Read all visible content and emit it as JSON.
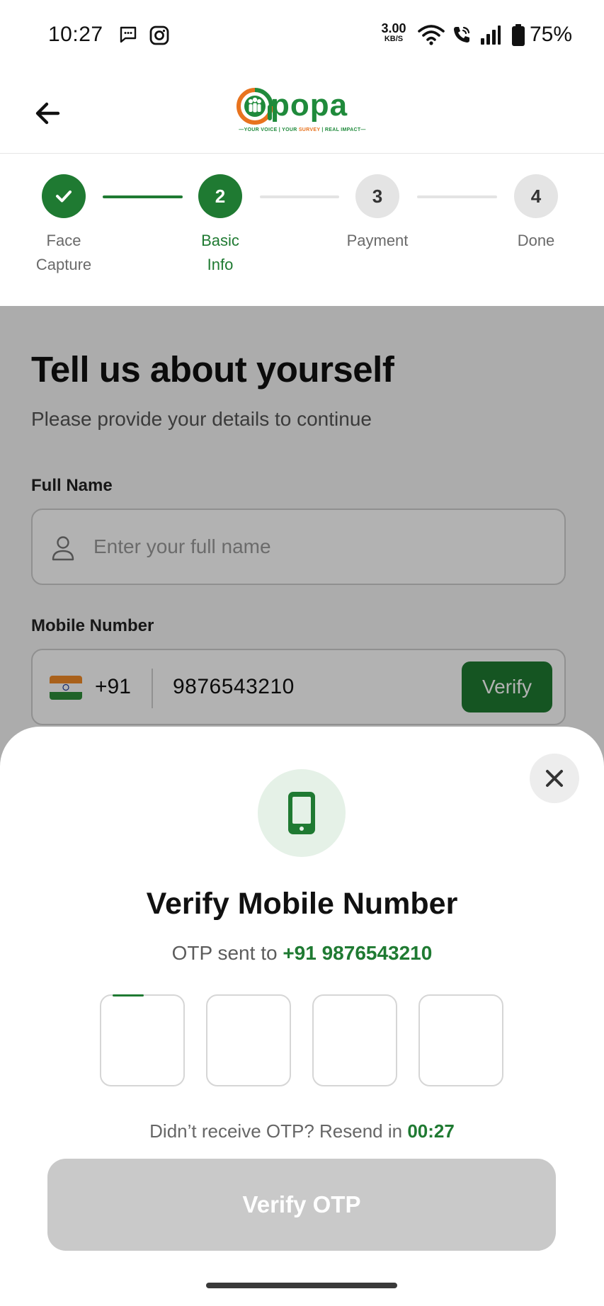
{
  "status_bar": {
    "time": "10:27",
    "net_speed_value": "3.00",
    "net_speed_unit": "KB/S",
    "battery_percent": "75%"
  },
  "header": {
    "logo_word": "popa",
    "logo_tagline_1": "—YOUR VOICE | YOUR ",
    "logo_tagline_2": "SURVEY",
    "logo_tagline_3": " | REAL IMPACT—"
  },
  "stepper": {
    "steps": [
      {
        "number": "",
        "label_1": "Face",
        "label_2": "Capture",
        "state": "done"
      },
      {
        "number": "2",
        "label_1": "Basic",
        "label_2": "Info",
        "state": "active"
      },
      {
        "number": "3",
        "label_1": "Payment",
        "label_2": "",
        "state": "todo"
      },
      {
        "number": "4",
        "label_1": "Done",
        "label_2": "",
        "state": "todo"
      }
    ]
  },
  "form": {
    "title": "Tell us about yourself",
    "subtitle": "Please provide your details to continue",
    "full_name_label": "Full Name",
    "full_name_placeholder": "Enter your full name",
    "mobile_label": "Mobile Number",
    "country_code": "+91",
    "mobile_value": "9876543210",
    "verify_label": "Verify"
  },
  "sheet": {
    "title": "Verify Mobile Number",
    "otp_sent_prefix": "OTP sent to ",
    "otp_sent_number": "+91 9876543210",
    "resend_prefix": "Didn’t receive OTP? Resend in ",
    "resend_timer": "00:27",
    "verify_otp_label": "Verify OTP"
  },
  "colors": {
    "brand_green": "#1f7a32",
    "brand_orange": "#e8731e",
    "disabled_button": "#c9c9c9"
  },
  "icons": [
    "message-icon",
    "instagram-icon",
    "wifi-icon",
    "call-icon",
    "signal-icon",
    "battery-icon",
    "back-arrow-icon",
    "check-icon",
    "person-icon",
    "india-flag-icon",
    "close-icon",
    "smartphone-icon"
  ]
}
